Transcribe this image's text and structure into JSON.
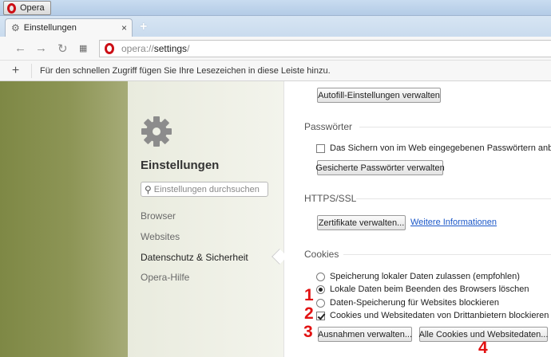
{
  "window": {
    "app_menu_label": "Opera"
  },
  "tab": {
    "title": "Einstellungen"
  },
  "address": {
    "scheme": "opera://",
    "host": "settings",
    "path": "/"
  },
  "bookmark_bar": {
    "hint": "Für den schnellen Zugriff fügen Sie Ihre Lesezeichen in diese Leiste hinzu."
  },
  "sidebar": {
    "title": "Einstellungen",
    "search_placeholder": "Einstellungen durchsuchen",
    "items": [
      {
        "label": "Browser"
      },
      {
        "label": "Websites"
      },
      {
        "label": "Datenschutz & Sicherheit",
        "active": true
      },
      {
        "label": "Opera-Hilfe"
      }
    ]
  },
  "main": {
    "autofill_button": "Autofill-Einstellungen verwalten",
    "passwords": {
      "heading": "Passwörter",
      "save_checkbox_label": "Das Sichern von im Web eingegebenen Passwörtern anbieten",
      "save_checkbox_checked": false,
      "manage_button": "Gesicherte Passwörter verwalten"
    },
    "https": {
      "heading": "HTTPS/SSL",
      "certificates_button": "Zertifikate verwalten...",
      "more_info_link": "Weitere Informationen"
    },
    "cookies": {
      "heading": "Cookies",
      "options": [
        {
          "label": "Speicherung lokaler Daten zulassen (empfohlen)",
          "selected": false
        },
        {
          "label": "Lokale Daten beim Beenden des Browsers löschen",
          "selected": true
        },
        {
          "label": "Daten-Speicherung für Websites blockieren",
          "selected": false
        }
      ],
      "third_party_checkbox_label": "Cookies und Websitedaten von Drittanbietern blockieren",
      "third_party_checked": true,
      "exceptions_button": "Ausnahmen verwalten...",
      "all_cookies_button": "Alle Cookies und Websitedaten..."
    }
  },
  "annotations": [
    "1",
    "2",
    "3",
    "4"
  ],
  "colors": {
    "opera_red": "#cc0f16",
    "annotation_red": "#e21212",
    "link_blue": "#1a57c8"
  }
}
